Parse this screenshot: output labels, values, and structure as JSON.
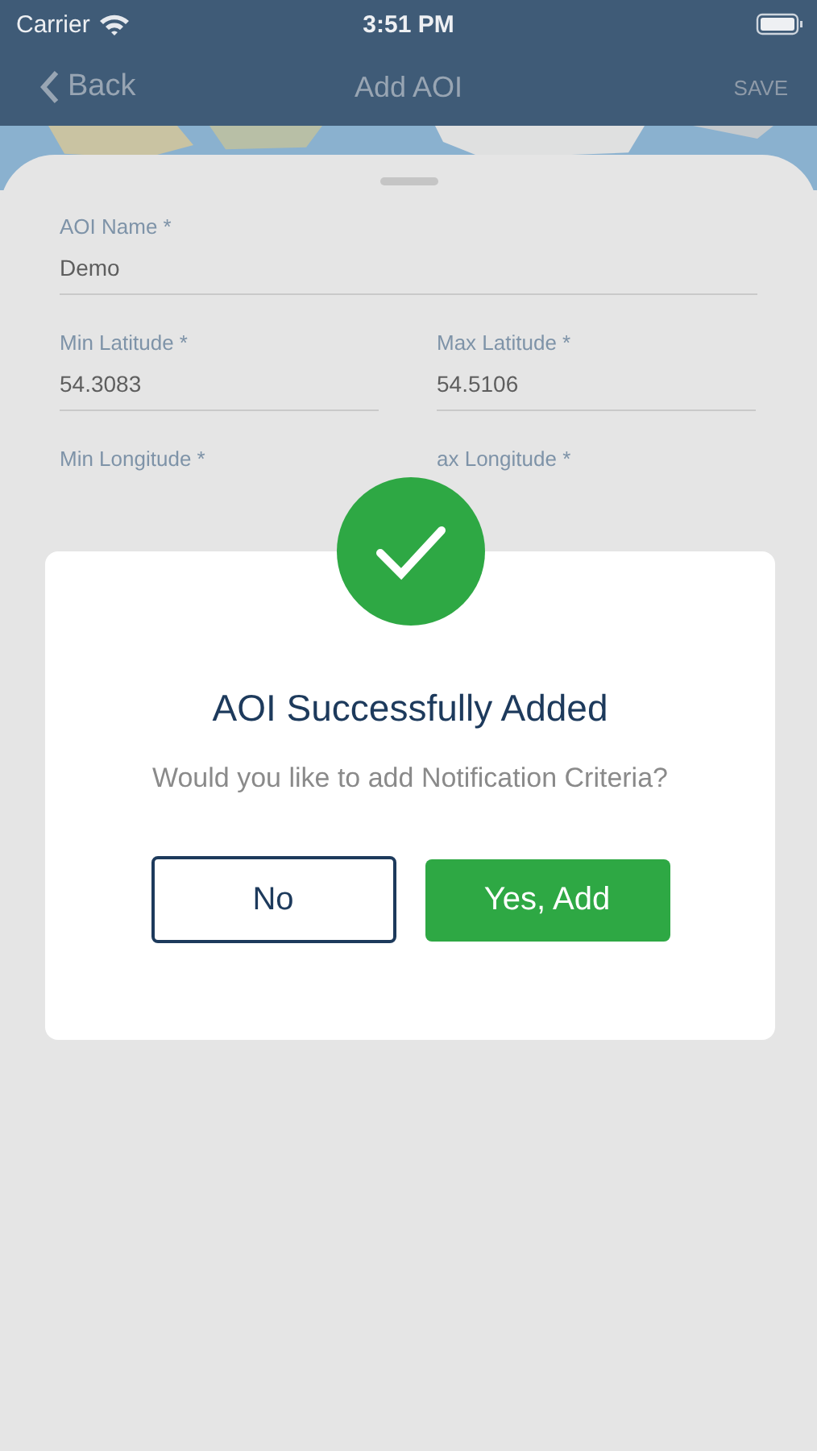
{
  "status_bar": {
    "carrier": "Carrier",
    "time": "3:51 PM"
  },
  "nav_bar": {
    "back": "Back",
    "title": "Add AOI",
    "action": "SAVE"
  },
  "form": {
    "fields": [
      {
        "label": "AOI Name *",
        "value": "Demo",
        "kind": "full"
      },
      {
        "label": "Min Latitude *",
        "value": "54.3083",
        "kind": "half"
      },
      {
        "label": "Max Latitude *",
        "value": "54.5106",
        "kind": "half"
      },
      {
        "label": "Min Longitude *",
        "kind": "half"
      },
      {
        "label": "ax Longitude *",
        "kind": "half"
      }
    ]
  },
  "dialog": {
    "title": "AOI Successfully Added",
    "message": "Would you like to add Notification Criteria?",
    "buttons": [
      {
        "label": "No",
        "kind": "outline"
      },
      {
        "label": "Yes, Add",
        "kind": "primary"
      }
    ]
  }
}
